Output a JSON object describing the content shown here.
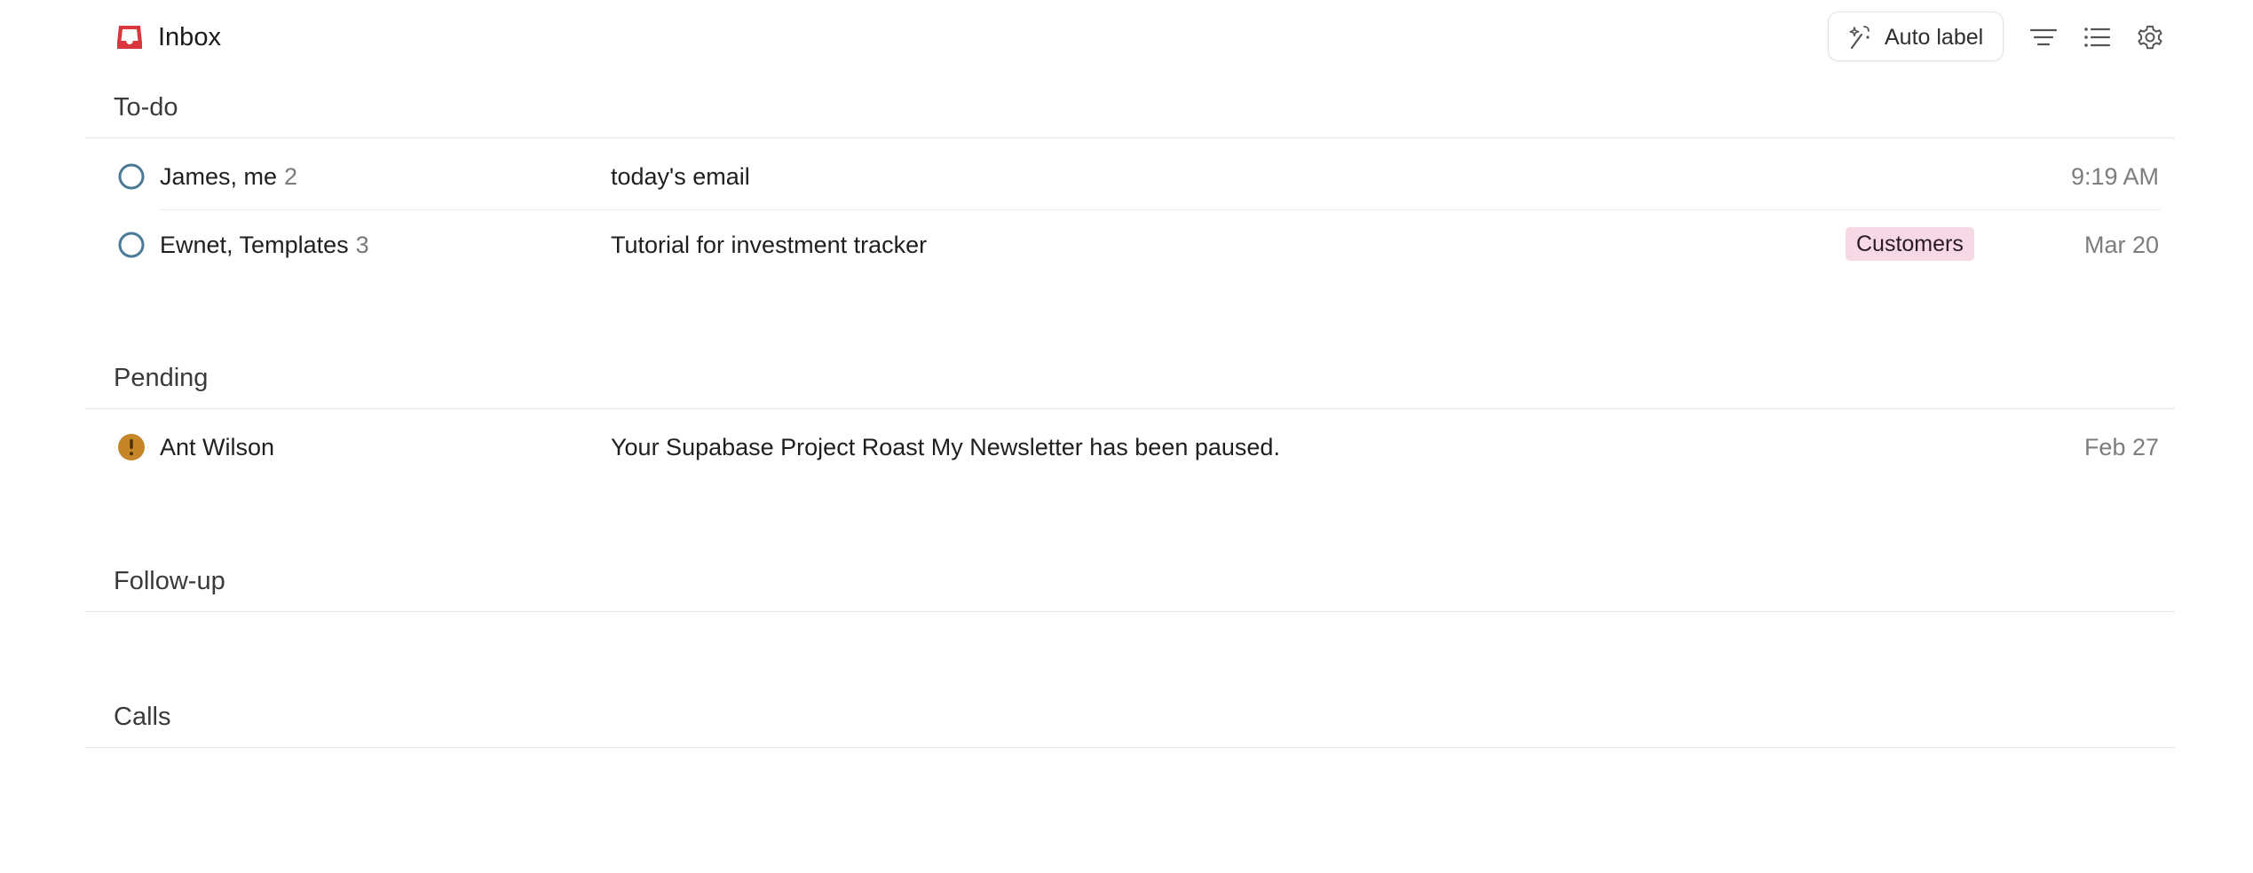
{
  "header": {
    "title": "Inbox",
    "inbox_icon": "inbox-tray-icon",
    "auto_label": "Auto label",
    "auto_label_icon": "magic-wand-icon",
    "tools": [
      "filter-icon",
      "list-icon",
      "gear-icon"
    ]
  },
  "colors": {
    "accent_red": "#d9363e",
    "todo_circle": "#4a7a96",
    "pending_warning": "#c5862a",
    "label_customers_bg": "#f7d9e6",
    "divider": "#e6e6e6"
  },
  "sections": {
    "todo": {
      "title": "To-do",
      "rows": [
        {
          "status_icon": "circle-outline-icon",
          "sender": "James, me",
          "count": "2",
          "subject": "today's email",
          "label": "",
          "date": "9:19 AM"
        },
        {
          "status_icon": "circle-outline-icon",
          "sender": "Ewnet, Templates",
          "count": "3",
          "subject": "Tutorial for investment tracker",
          "label": "Customers",
          "date": "Mar 20"
        }
      ]
    },
    "pending": {
      "title": "Pending",
      "rows": [
        {
          "status_icon": "warning-circle-icon",
          "sender": "Ant Wilson",
          "count": "",
          "subject": "Your Supabase Project Roast My Newsletter has been paused.",
          "label": "",
          "date": "Feb 27"
        }
      ]
    },
    "followup": {
      "title": "Follow-up",
      "rows": []
    },
    "calls": {
      "title": "Calls",
      "rows": []
    }
  }
}
